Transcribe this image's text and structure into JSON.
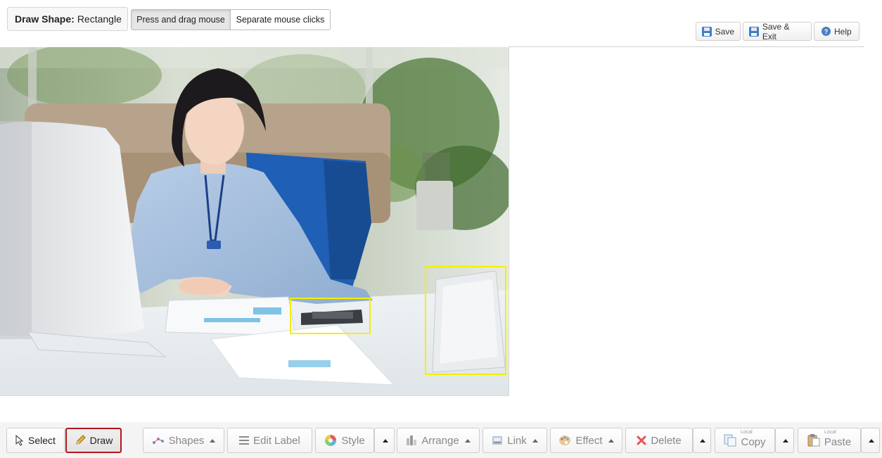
{
  "header": {
    "mode_prefix": "Draw Shape:",
    "mode_value": "Rectangle",
    "options": [
      "Press and drag mouse",
      "Separate mouse clicks"
    ],
    "active_option": "Press and drag mouse"
  },
  "actions": {
    "save": "Save",
    "save_exit": "Save & Exit",
    "help": "Help"
  },
  "toolbar": {
    "select": "Select",
    "draw": "Draw",
    "shapes": "Shapes",
    "edit_label": "Edit Label",
    "style": "Style",
    "arrange": "Arrange",
    "link": "Link",
    "effect": "Effect",
    "delete": "Delete",
    "copy": "Copy",
    "copy_caption": "Local",
    "paste": "Paste",
    "paste_caption": "Local"
  },
  "colors": {
    "annotation_box": "#f4ef00",
    "active_tool_border": "#b4151d"
  },
  "icons": {
    "select": "cursor-arrow-icon",
    "draw": "pencil-icon",
    "shapes": "shapes-icon",
    "edit_label": "list-icon",
    "style": "color-wheel-icon",
    "arrange": "arrange-icon",
    "link": "link-icon",
    "effect": "palette-icon",
    "delete": "x-icon",
    "copy": "copy-icon",
    "paste": "paste-icon"
  }
}
